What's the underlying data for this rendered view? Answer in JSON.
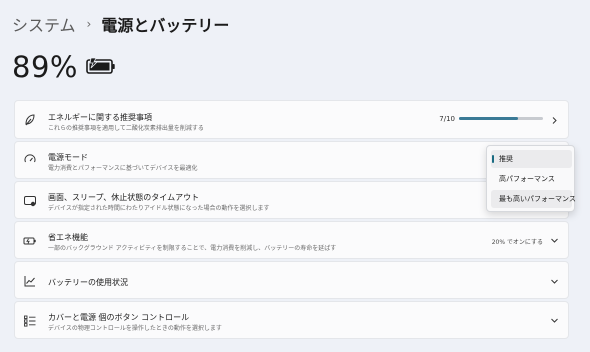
{
  "breadcrumb": {
    "parent": "システム",
    "separator": "›",
    "current": "電源とバッテリー"
  },
  "battery": {
    "percent_text": "89%",
    "charging": true,
    "icon": "battery-charging-icon"
  },
  "cards": {
    "energy": {
      "title": "エネルギーに関する推奨事項",
      "subtitle": "これらの推奨事項を適用して二酸化炭素排出量を削減する",
      "count": "7/10",
      "progress": 0.7,
      "icon": "leaf-icon"
    },
    "power_mode": {
      "title": "電源モード",
      "subtitle": "電力消費とパフォーマンスに基づいてデバイスを最適化",
      "icon": "power-mode-icon"
    },
    "screen_sleep": {
      "title": "画面、スリープ、休止状態のタイムアウト",
      "subtitle": "デバイスが指定された時間にわたりアイドル状態になった場合の動作を選択します",
      "icon": "screen-timeout-icon"
    },
    "energy_saver": {
      "title": "省エネ機能",
      "subtitle": "一部のバックグラウンド アクティビティを制限することで、電力消費を削減し、バッテリーの寿命を延ばす",
      "value": "20% でオンにする",
      "icon": "battery-saver-icon"
    },
    "battery_usage": {
      "title": "バッテリーの使用状況",
      "icon": "chart-icon"
    },
    "lid_buttons": {
      "title": "カバーと電源 個のボタン コントロール",
      "subtitle": "デバイスの物理コントロールを操作したときの動作を選択します",
      "icon": "controls-list-icon"
    }
  },
  "power_mode_menu": {
    "options": [
      "推奨",
      "高パフォーマンス",
      "最も高いパフォーマンス"
    ],
    "selected": "推奨",
    "accent": "#1a6b82"
  },
  "colors": {
    "accent": "#3a7a96",
    "background": "#eef1f7"
  }
}
